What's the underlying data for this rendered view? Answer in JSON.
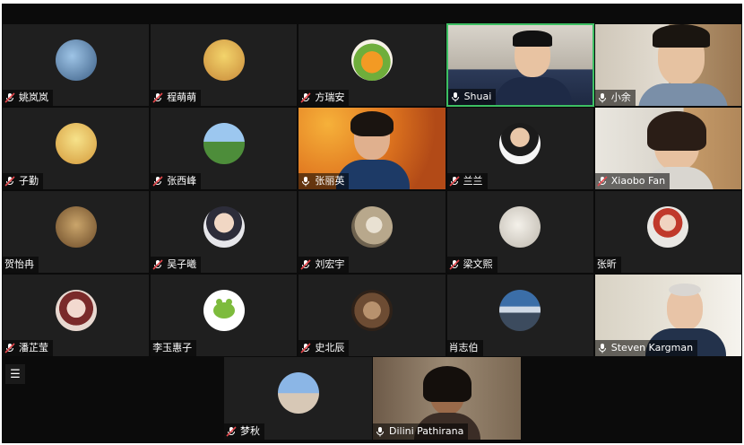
{
  "participants": [
    {
      "name": "姚岚岚",
      "muted": true
    },
    {
      "name": "程萌萌",
      "muted": true
    },
    {
      "name": "方瑞安",
      "muted": true
    },
    {
      "name": "Shuai",
      "muted": false
    },
    {
      "name": "小余",
      "muted": false
    },
    {
      "name": "子勤",
      "muted": true
    },
    {
      "name": "张西峰",
      "muted": true
    },
    {
      "name": "张丽英",
      "muted": false
    },
    {
      "name": "兰兰",
      "muted": true
    },
    {
      "name": "Xiaobo Fan",
      "muted": true
    },
    {
      "name": "贺怡冉",
      "muted": null
    },
    {
      "name": "吴子曦",
      "muted": true
    },
    {
      "name": "刘宏宇",
      "muted": true
    },
    {
      "name": "梁文熙",
      "muted": true
    },
    {
      "name": "张昕",
      "muted": null
    },
    {
      "name": "潘芷莹",
      "muted": true
    },
    {
      "name": "李玉惠子",
      "muted": null
    },
    {
      "name": "史北辰",
      "muted": true
    },
    {
      "name": "肖志伯",
      "muted": null
    },
    {
      "name": "Steven Kargman",
      "muted": false
    }
  ],
  "bottom": [
    {
      "name": "梦秋",
      "muted": true
    },
    {
      "name": "Dilini Pathirana",
      "muted": false
    }
  ],
  "colors": {
    "muted_mic": "#e5484d",
    "active_border": "#3dbf63",
    "tile_bg": "#1f1f1f"
  },
  "icons": {
    "menu": "list-menu-icon",
    "mic_on": "microphone-icon",
    "mic_off": "microphone-muted-icon"
  }
}
